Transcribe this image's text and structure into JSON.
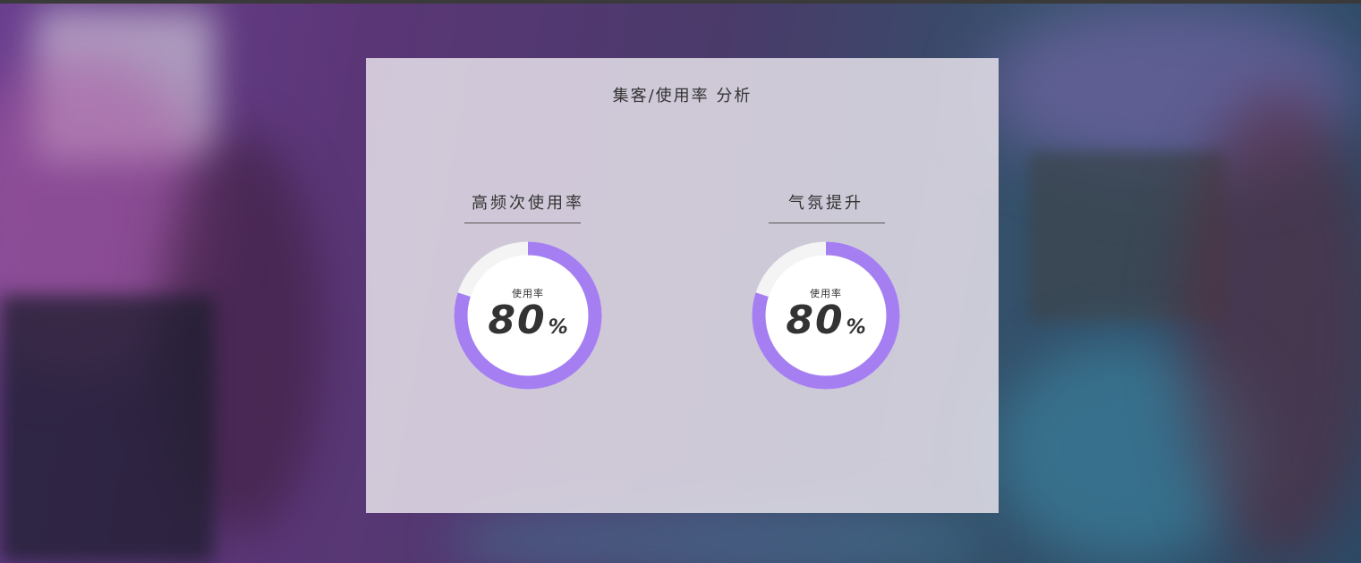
{
  "panel": {
    "title": "集客/使用率 分析"
  },
  "sections": [
    {
      "title": "高频次使用率",
      "gauge": {
        "caption": "使用率",
        "value": "80",
        "unit": "%",
        "fraction": 0.8
      }
    },
    {
      "title": "气氛提升",
      "gauge": {
        "caption": "使用率",
        "value": "80",
        "unit": "%",
        "fraction": 0.8
      }
    }
  ],
  "colors": {
    "ring_accent": "#a57ff2",
    "ring_track": "#f4f4f4",
    "panel_text": "#333333"
  }
}
